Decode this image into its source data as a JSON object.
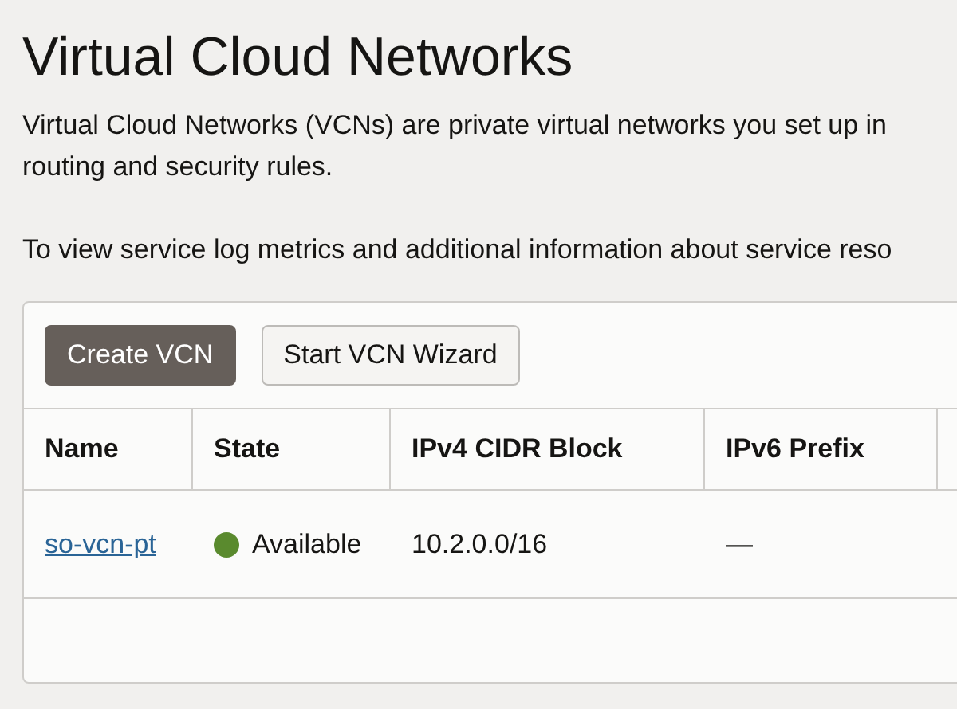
{
  "title": "Virtual Cloud Networks",
  "description_lines": [
    "Virtual Cloud Networks (VCNs) are private virtual networks you set up in",
    "routing and security rules."
  ],
  "info_line": "To view service log metrics and additional information about service reso",
  "buttons": [
    {
      "label": "Create VCN",
      "kind": "primary"
    },
    {
      "label": "Start VCN Wizard",
      "kind": "secondary"
    }
  ],
  "table": {
    "columns": [
      "Name",
      "State",
      "IPv4 CIDR Block",
      "IPv6 Prefix"
    ],
    "rows": [
      {
        "name": "so-vcn-pt",
        "state": "Available",
        "color": "#5a8a2e",
        "ipv4_cidr_block": "10.2.0.0/16",
        "ipv6_prefix": "—"
      }
    ]
  }
}
